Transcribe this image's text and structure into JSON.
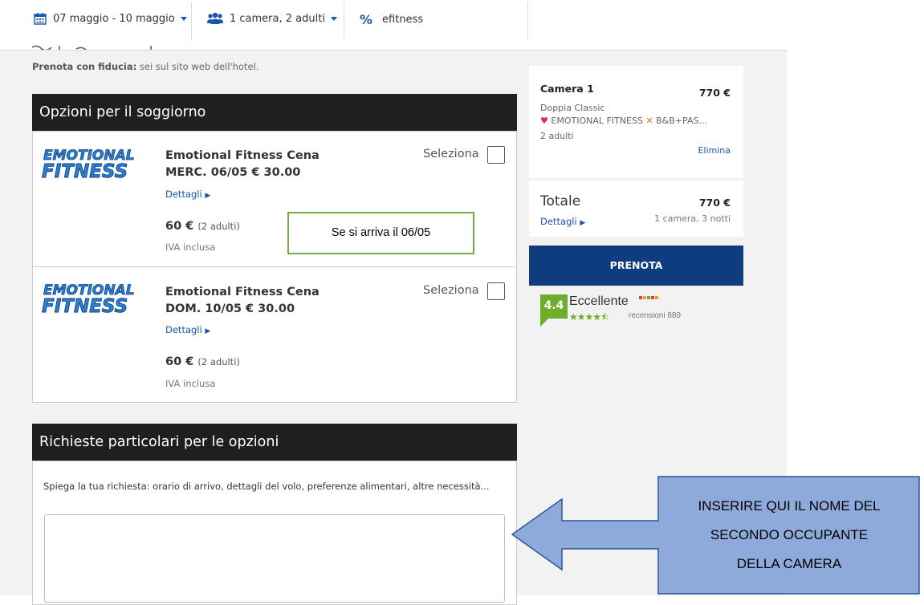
{
  "topbar": {
    "dates": "07 maggio - 10 maggio",
    "guests": "1 camera, 2 adulti",
    "promo": "efitness"
  },
  "page": {
    "subtitle_bold": "Prenota con fiducia:",
    "subtitle_rest": " sei sul sito web dell'hotel."
  },
  "options": {
    "heading": "Opzioni per il soggiorno",
    "items": [
      {
        "logo_line1": "EMOTIONAL",
        "logo_line2": "FITNESS",
        "title_line1": "Emotional Fitness Cena",
        "title_line2": "MERC. 06/05 € 30.00",
        "details": "Dettagli",
        "price": "60 €",
        "price_note": "(2 adulti)",
        "tax": "IVA inclusa",
        "select_label": "Seleziona"
      },
      {
        "logo_line1": "EMOTIONAL",
        "logo_line2": "FITNESS",
        "title_line1": "Emotional Fitness Cena",
        "title_line2": "DOM. 10/05 € 30.00",
        "details": "Dettagli",
        "price": "60 €",
        "price_note": "(2 adulti)",
        "tax": "IVA inclusa",
        "select_label": "Seleziona"
      }
    ]
  },
  "requests": {
    "heading": "Richieste particolari per le opzioni",
    "prompt": "Spiega la tua richiesta: orario di arrivo, dettagli del volo, preferenze alimentari, altre necessità...",
    "value": ""
  },
  "summary": {
    "room_title": "Camera 1",
    "room_price": "770 €",
    "room_type": "Doppia Classic",
    "room_plan": "EMOTIONAL FITNESS",
    "room_plan_tail": "B&B+PAS...",
    "guests": "2 adulti",
    "remove": "Elimina",
    "total_label": "Totale",
    "total_price": "770 €",
    "details": "Dettagli",
    "nights": "1 camera, 3 notti",
    "book": "PRENOTA"
  },
  "rating": {
    "score": "4.4",
    "label": "Eccellente",
    "reviews": "recensioni 889",
    "stars": 4.5
  },
  "annotations": {
    "arrival_note": "Se si arriva il 06/05",
    "arrow_lines": [
      "INSERIRE QUI IL NOME DEL",
      "SECONDO OCCUPANTE",
      "DELLA CAMERA"
    ]
  },
  "colors": {
    "accent_blue": "#1a56a8",
    "header_dark": "#1f1f1f",
    "book_button": "#0f3c7e",
    "rating_green": "#6cae2a",
    "annotation_fill": "#8eaadb",
    "annotation_border": "#2f5597",
    "note_border": "#70ad47"
  }
}
